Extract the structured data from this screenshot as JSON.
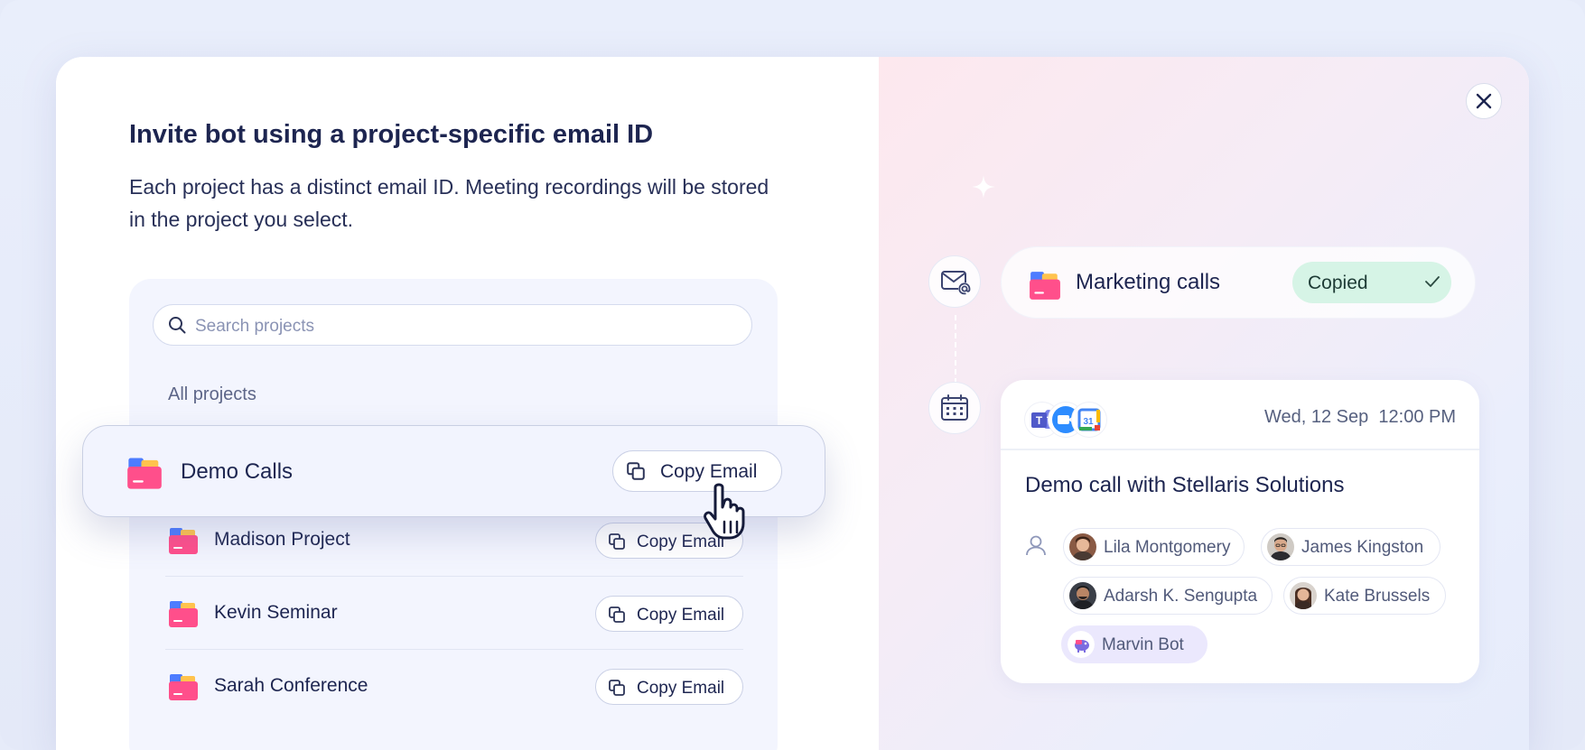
{
  "dialog": {
    "title": "Invite bot using a project-specific email ID",
    "description": "Each project has a distinct email ID. Meeting recordings will be stored in the project you select."
  },
  "search": {
    "placeholder": "Search projects"
  },
  "list": {
    "section_label": "All projects",
    "copy_label": "Copy Email",
    "hovered": {
      "name": "Demo Calls"
    },
    "projects": [
      {
        "name": "Madison Project"
      },
      {
        "name": "Kevin Seminar"
      },
      {
        "name": "Sarah Conference"
      }
    ]
  },
  "preview": {
    "email_project": {
      "name": "Marketing calls",
      "status": "Copied"
    },
    "event": {
      "date": "Wed, 12 Sep",
      "time": "12:00 PM",
      "title": "Demo call with Stellaris Solutions",
      "attendees": [
        {
          "name": "Lila Montgomery"
        },
        {
          "name": "James Kingston"
        },
        {
          "name": "Adarsh K. Sengupta"
        },
        {
          "name": "Kate Brussels"
        },
        {
          "name": "Marvin Bot"
        }
      ],
      "calendar_day": "31"
    }
  },
  "colors": {
    "accent_pink": "#ff4f8b",
    "folder_yellow": "#ffc34d",
    "folder_blue": "#4d7cff",
    "copied_bg": "#d6f4e6",
    "title_text": "#1d2550"
  },
  "icons": [
    "search-icon",
    "folder-icon",
    "copy-icon",
    "pointer-hand-icon",
    "close-icon",
    "sparkle-icon",
    "email-at-icon",
    "calendar-icon",
    "check-icon",
    "teams-icon",
    "zoom-icon",
    "google-calendar-icon",
    "person-icon"
  ]
}
